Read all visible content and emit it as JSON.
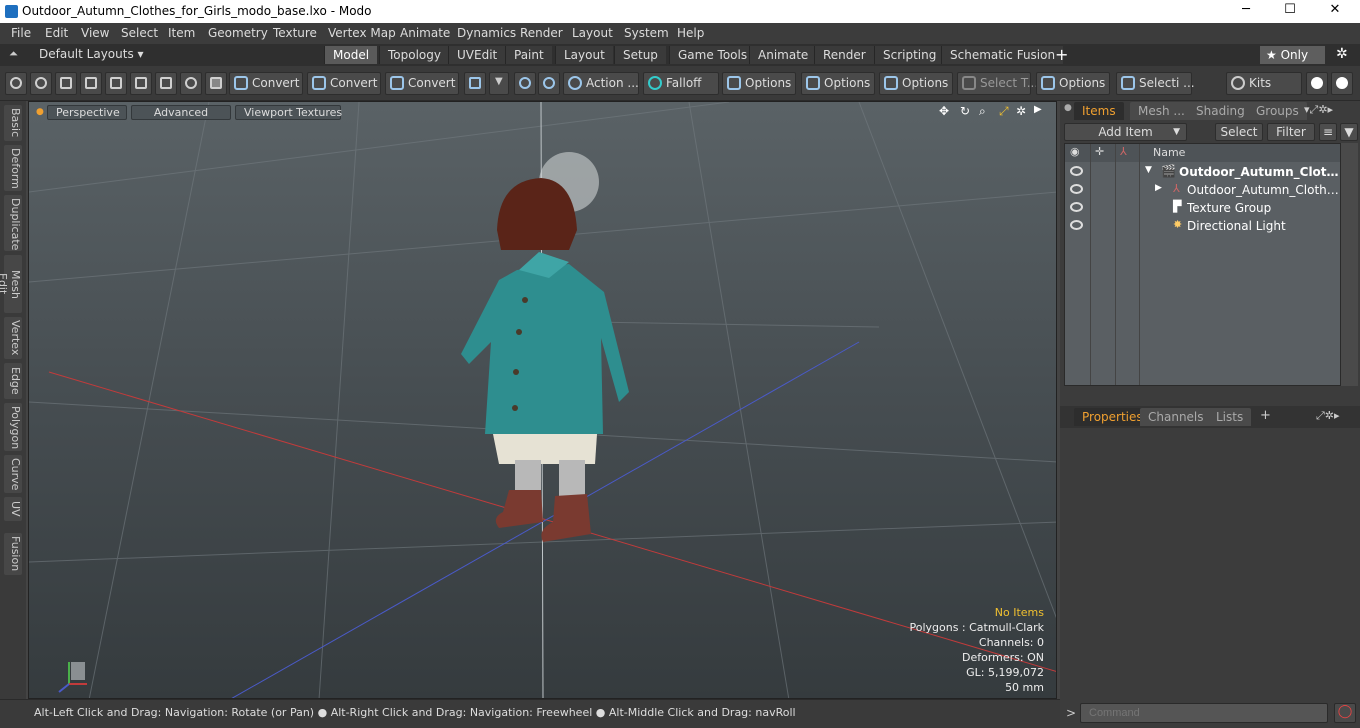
{
  "window": {
    "title": "Outdoor_Autumn_Clothes_for_Girls_modo_base.lxo - Modo",
    "minimize": "─",
    "maximize": "☐",
    "close": "✕"
  },
  "menu": [
    "File",
    "Edit",
    "View",
    "Select",
    "Item",
    "Geometry",
    "Texture",
    "Vertex Map",
    "Animate",
    "Dynamics",
    "Render",
    "Layout",
    "System",
    "Help"
  ],
  "layouts": {
    "label": "Default Layouts ▾",
    "tabs": [
      "Model",
      "Topology",
      "UVEdit",
      "Paint",
      "Layout",
      "Setup",
      "Game Tools",
      "Animate",
      "Render",
      "Scripting",
      "Schematic Fusion"
    ],
    "active": "Model",
    "add": "+",
    "only": "★  Only",
    "gear": "✲"
  },
  "toolbar": {
    "convert1": "Convert",
    "convert2": "Convert",
    "convert3": "Convert",
    "action": "Action",
    "action_more": "...",
    "falloff": "Falloff",
    "options1": "Options",
    "options2": "Options",
    "options3": "Options",
    "select_t": "Select T...",
    "options4": "Options",
    "selecti": "Selecti ...",
    "kits": "Kits"
  },
  "left_tabs": [
    "Basic",
    "Deform",
    "Duplicate",
    "Mesh Edit",
    "Vertex",
    "Edge",
    "Polygon",
    "Curve",
    "UV",
    "Fusion"
  ],
  "viewport": {
    "perspective": "Perspective",
    "advanced": "Advanced",
    "textures": "Viewport Textures",
    "stats": {
      "no_items": "No Items",
      "polygons": "Polygons : Catmull-Clark",
      "channels": "Channels: 0",
      "deformers": "Deformers: ON",
      "gl": "GL: 5,199,072",
      "size": "50 mm"
    }
  },
  "status": {
    "hint": "Alt-Left Click and Drag: Navigation: Rotate (or Pan) ● Alt-Right Click and Drag: Navigation: Freewheel ● Alt-Middle Click and Drag: navRoll"
  },
  "items_panel": {
    "tabs": [
      "Items",
      "Mesh ...",
      "Shading",
      "Groups"
    ],
    "add_item": "Add Item",
    "select": "Select",
    "filter": "Filter",
    "col_name": "Name",
    "rows": [
      {
        "name": "Outdoor_Autumn_Clothes ...",
        "bold": true
      },
      {
        "name": "Outdoor_Autumn_Clothes_f..."
      },
      {
        "name": "Texture Group"
      },
      {
        "name": "Directional Light"
      }
    ]
  },
  "props_panel": {
    "tabs": [
      "Properties",
      "Channels",
      "Lists"
    ],
    "add": "+"
  },
  "command": {
    "placeholder": "Command",
    "prompt": ">"
  },
  "colors": {
    "accent": "#f0a030",
    "coat": "#2e8e8f",
    "hat": "#5a2418",
    "boot": "#7a3a30"
  }
}
